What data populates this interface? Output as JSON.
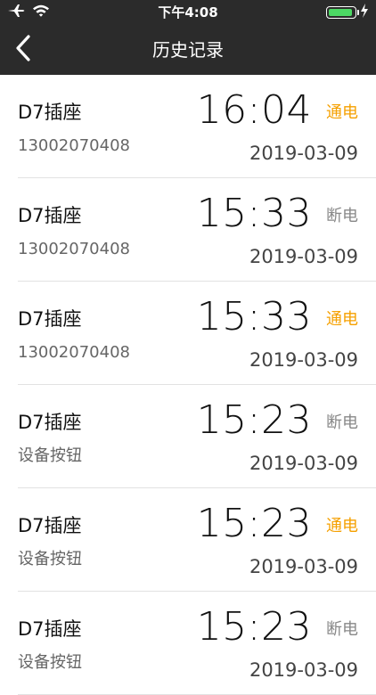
{
  "status_bar": {
    "time": "下午4:08",
    "battery_color": "#4cd964",
    "icons": [
      "airplane-icon",
      "wifi-icon",
      "battery-icon",
      "charging-icon"
    ]
  },
  "nav": {
    "title": "历史记录",
    "back_icon": "chevron-left-icon"
  },
  "colors": {
    "on": "#f5a000",
    "off": "#888888",
    "bar": "#2b2b2b"
  },
  "records": [
    {
      "name": "D7插座",
      "source": "13002070408",
      "time": "16:04",
      "status": "通电",
      "state": "on",
      "date": "2019-03-09"
    },
    {
      "name": "D7插座",
      "source": "13002070408",
      "time": "15:33",
      "status": "断电",
      "state": "off",
      "date": "2019-03-09"
    },
    {
      "name": "D7插座",
      "source": "13002070408",
      "time": "15:33",
      "status": "通电",
      "state": "on",
      "date": "2019-03-09"
    },
    {
      "name": "D7插座",
      "source": "设备按钮",
      "time": "15:23",
      "status": "断电",
      "state": "off",
      "date": "2019-03-09"
    },
    {
      "name": "D7插座",
      "source": "设备按钮",
      "time": "15:23",
      "status": "通电",
      "state": "on",
      "date": "2019-03-09"
    },
    {
      "name": "D7插座",
      "source": "设备按钮",
      "time": "15:23",
      "status": "断电",
      "state": "off",
      "date": "2019-03-09"
    }
  ]
}
